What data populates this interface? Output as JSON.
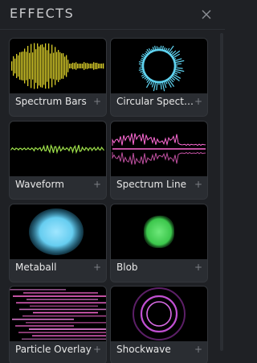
{
  "panel": {
    "title": "EFFECTS",
    "close_icon": "close-icon"
  },
  "effects": [
    {
      "label": "Spectrum Bars",
      "add": "+",
      "preview": "spectrum-bars"
    },
    {
      "label": "Circular Spect…",
      "add": "+",
      "preview": "circular-spectrum"
    },
    {
      "label": "Waveform",
      "add": "+",
      "preview": "waveform"
    },
    {
      "label": "Spectrum Line",
      "add": "+",
      "preview": "spectrum-line"
    },
    {
      "label": "Metaball",
      "add": "+",
      "preview": "metaball"
    },
    {
      "label": "Blob",
      "add": "+",
      "preview": "blob"
    },
    {
      "label": "Particle Overlay",
      "add": "+",
      "preview": "particle-overlay"
    },
    {
      "label": "Shockwave",
      "add": "+",
      "preview": "shockwave"
    }
  ],
  "colors": {
    "background": "#1f2125",
    "card": "#2a2d32",
    "yellow": "#d8cc2a",
    "cyan": "#5fd3f0",
    "green": "#9ee04a",
    "pink": "#ff6bd6",
    "blob_green": "#48d25c",
    "purple": "#c04fd1"
  }
}
